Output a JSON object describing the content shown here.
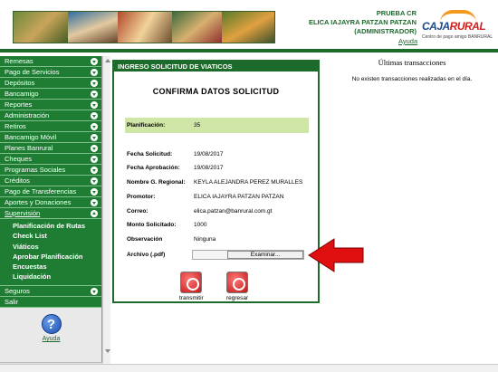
{
  "header": {
    "branch": "PRUEBA CR",
    "user_name": "ELICA IAJAYRA PATZAN PATZAN",
    "role": "(ADMINISTRADOR)",
    "help_link": "Ayuda",
    "logo_text_a": "CAJA",
    "logo_text_b": "RURAL",
    "logo_sub": "Centro de pago amigo BANRURAL"
  },
  "sidebar": {
    "items": [
      {
        "label": "Remesas"
      },
      {
        "label": "Pago de Servicios"
      },
      {
        "label": "Depósitos"
      },
      {
        "label": "Bancamigo"
      },
      {
        "label": "Reportes"
      },
      {
        "label": "Administración"
      },
      {
        "label": "Retiros"
      },
      {
        "label": "Bancamigo Móvil"
      },
      {
        "label": "Planes Banrural"
      },
      {
        "label": "Cheques"
      },
      {
        "label": "Programas Sociales"
      },
      {
        "label": "Créditos"
      },
      {
        "label": "Pago de Transferencias"
      },
      {
        "label": "Aportes y Donaciones"
      },
      {
        "label": "Supervisión"
      }
    ],
    "submenu": [
      {
        "label": "Planificación de Rutas"
      },
      {
        "label": "Check List"
      },
      {
        "label": "Viáticos"
      },
      {
        "label": "Aprobar Planificación"
      },
      {
        "label": "Encuestas"
      },
      {
        "label": "Liquidación"
      }
    ],
    "after": [
      {
        "label": "Seguros"
      },
      {
        "label": "Salir"
      }
    ],
    "help_label": "Ayuda"
  },
  "panel": {
    "title": "INGRESO SOLICITUD DE VIATICOS",
    "confirm_title": "CONFIRMA DATOS SOLICITUD",
    "planificacion_label": "Planificación:",
    "planificacion_value": "35",
    "fields": [
      {
        "label": "Fecha Solicitud:",
        "value": "19/08/2017"
      },
      {
        "label": "Fecha Aprobación:",
        "value": "19/08/2017"
      },
      {
        "label": "Nombre G. Regional:",
        "value": "KEYLA ALEJANDRA PEREZ MURALLES"
      },
      {
        "label": "Promotor:",
        "value": "ELICA IAJAYRA PATZAN PATZAN"
      },
      {
        "label": "Correo:",
        "value": "elica.patzan@banrural.com.gt"
      },
      {
        "label": "Monto Solicitado:",
        "value": "1000"
      },
      {
        "label": "Observación",
        "value": "Ninguna"
      }
    ],
    "file_label": "Archivo (.pdf)",
    "file_button": "Examinar...",
    "transmit_label": "transmitir",
    "back_label": "regresar"
  },
  "transactions": {
    "title": "Últimas transacciones",
    "message": "No existen transacciones realizadas en el día."
  },
  "colors": {
    "menu_green": "#1e7d33",
    "highlight": "#cfe6a7",
    "arrow_red": "#e01010"
  }
}
